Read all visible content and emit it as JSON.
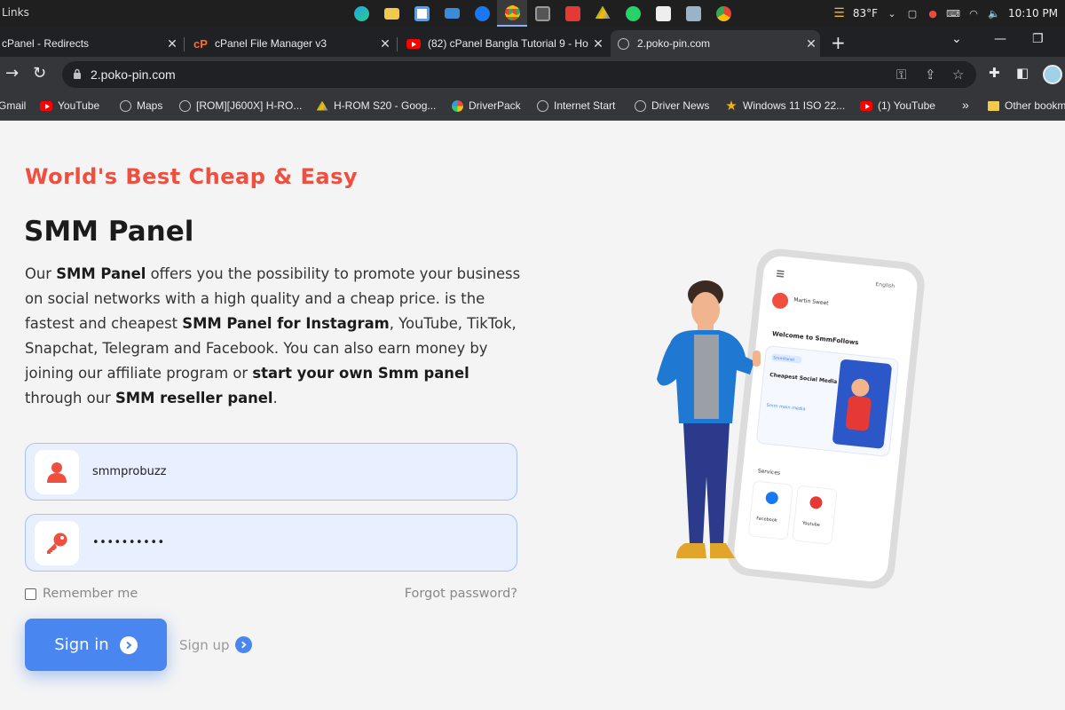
{
  "taskbar": {
    "left_label": "Links",
    "weather": "83°F",
    "time": "10:10 PM"
  },
  "tabs": [
    {
      "title": "cPanel - Redirects",
      "icon": "cpanel-icon"
    },
    {
      "title": "cPanel File Manager v3",
      "icon": "cpanel-icon"
    },
    {
      "title": "(82) cPanel Bangla Tutorial 9 - Ho",
      "icon": "youtube-icon"
    },
    {
      "title": "2.poko-pin.com",
      "icon": "globe-icon"
    }
  ],
  "address_bar": {
    "url": "2.poko-pin.com"
  },
  "bookmarks": [
    {
      "label": "Gmail"
    },
    {
      "label": "YouTube"
    },
    {
      "label": "Maps"
    },
    {
      "label": "[ROM][J600X] H-RO..."
    },
    {
      "label": "H-ROM S20 - Goog..."
    },
    {
      "label": "DriverPack"
    },
    {
      "label": "Internet Start"
    },
    {
      "label": "Driver News"
    },
    {
      "label": "Windows 11 ISO 22..."
    },
    {
      "label": "(1) YouTube"
    },
    {
      "label": "Other bookm"
    }
  ],
  "bookmarks_more": "»",
  "hero": {
    "tagline": "World's Best Cheap & Easy",
    "title": "SMM Panel",
    "description": {
      "p1": "Our ",
      "b1": "SMM Panel",
      "p2": " offers you the possibility to promote your business on social networks with a high quality and a cheap price.   is the fastest and cheapest ",
      "b2": "SMM Panel for Instagram",
      "p3": ", YouTube, TikTok, Snapchat, Telegram and Facebook. You can also earn money by joining our affiliate program or ",
      "b3": "start your own Smm panel",
      "p4": " through our ",
      "b4": "SMM reseller panel",
      "p5": "."
    }
  },
  "login": {
    "username_value": "smmprobuzz",
    "password_value": "••••••••••",
    "remember_label": "Remember me",
    "forgot_label": "Forgot password?",
    "signin_label": "Sign in",
    "signup_label": "Sign up"
  },
  "phone_mockup": {
    "lang": "English",
    "user_name": "Martin Sweet",
    "welcome": "Welcome to SmmFollows",
    "badge": "SmmPanel",
    "card_title": "Cheapest Social Media Service",
    "card_link": "Smm main media",
    "services_label": "Services",
    "service_1": "Facebook",
    "service_2": "Youtube"
  },
  "colors": {
    "accent_red": "#f04e3e",
    "primary_blue": "#4a86f0",
    "field_bg": "#e8efff"
  }
}
